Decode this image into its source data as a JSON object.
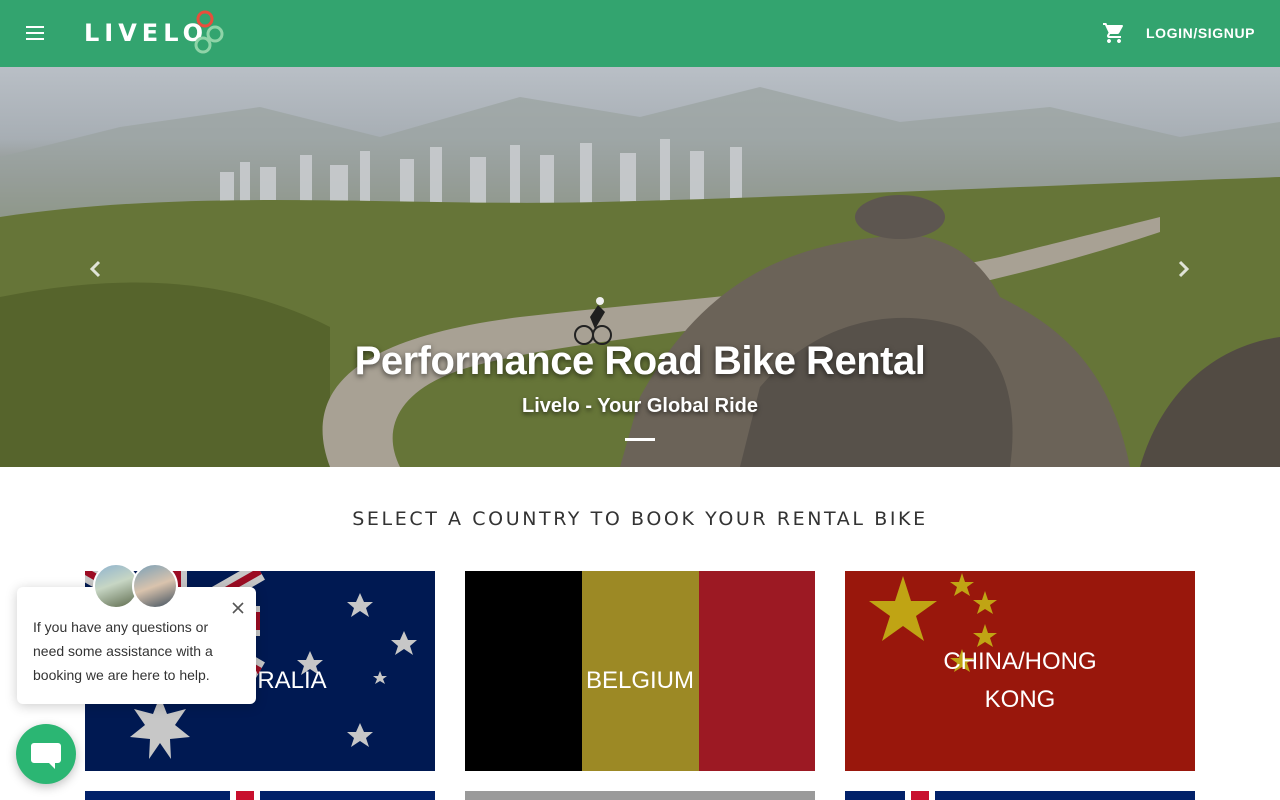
{
  "header": {
    "logo_text": "LIVELO",
    "login_label": "LOGIN/SIGNUP",
    "menu_icon": "hamburger-menu-icon",
    "cart_icon": "shopping-cart-icon",
    "brand_color": "#33a46f"
  },
  "hero": {
    "title": "Performance Road Bike Rental",
    "subtitle": "Livelo - Your Global Ride",
    "prev_icon": "chevron-left-icon",
    "next_icon": "chevron-right-icon"
  },
  "countries": {
    "heading": "SELECT A COUNTRY TO BOOK YOUR RENTAL BIKE",
    "cards": [
      {
        "name": "AUSTRALIA",
        "label_visible": "RALIA"
      },
      {
        "name": "BELGIUM"
      },
      {
        "name": "CHINA/HONG",
        "name_line2": "KONG"
      }
    ]
  },
  "chat": {
    "message": "If you have any questions or need some assistance with a booking we are here to help.",
    "close_icon": "close-icon",
    "launcher_icon": "chat-bubble-icon",
    "launcher_color": "#2bb673"
  }
}
